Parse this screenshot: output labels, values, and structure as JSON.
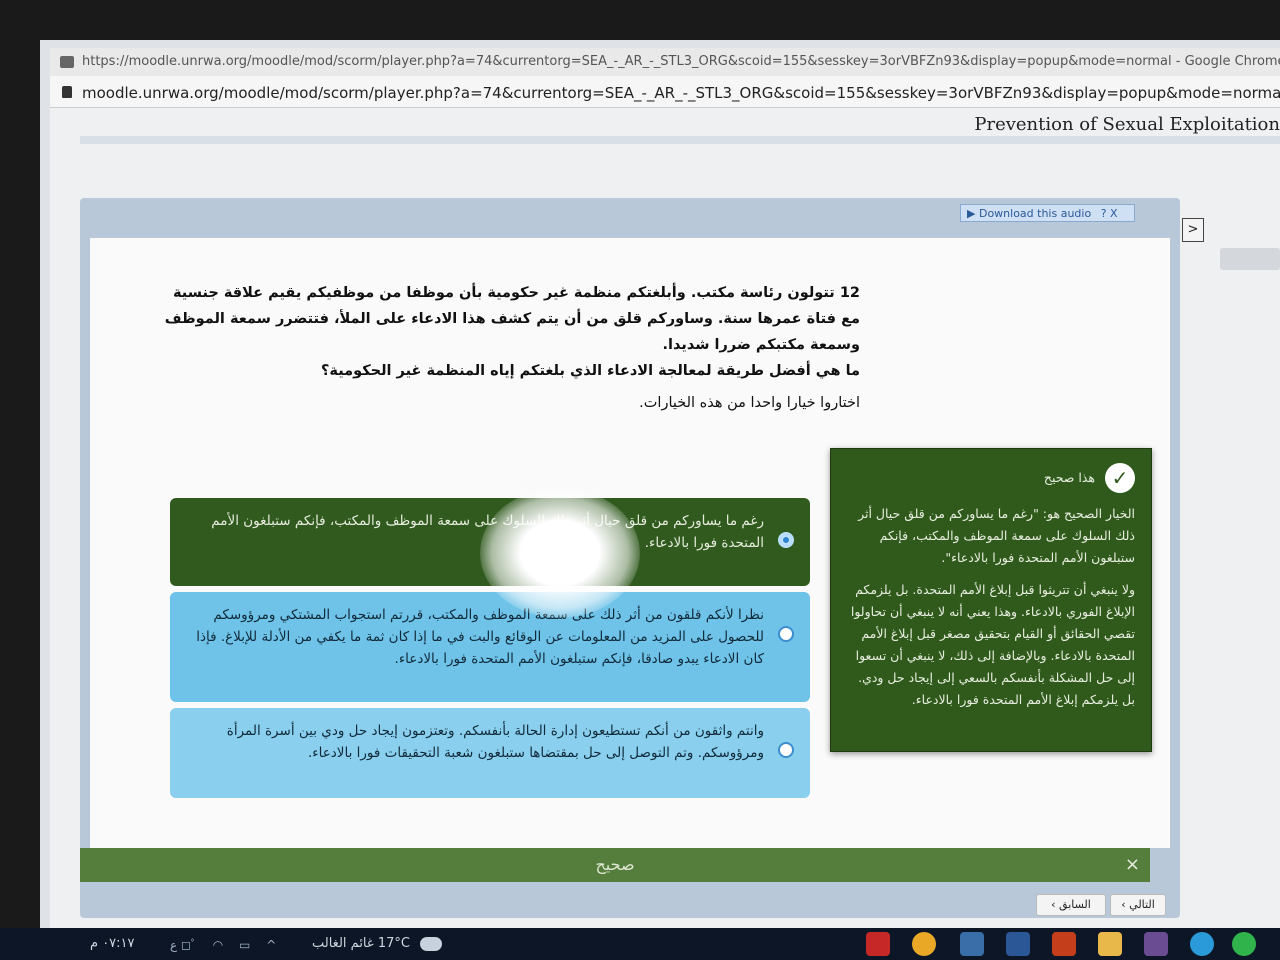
{
  "browser": {
    "title_bar": "https://moodle.unrwa.org/moodle/mod/scorm/player.php?a=74&currentorg=SEA_-_AR_-_STL3_ORG&scoid=155&sesskey=3orVBFZn93&display=popup&mode=normal - Google Chrome",
    "address": "moodle.unrwa.org/moodle/mod/scorm/player.php?a=74&currentorg=SEA_-_AR_-_STL3_ORG&scoid=155&sesskey=3orVBFZn93&display=popup&mode=normal"
  },
  "course": {
    "title": "Prevention of Sexual Exploitation"
  },
  "player": {
    "audio_label": "Download this audio",
    "audio_help": "? X",
    "side_next": ">"
  },
  "question": {
    "text": "12 تتولون رئاسة مكتب. وأبلغتكم منظمة غير حكومية بأن موظفا من موظفيكم يقيم علاقة جنسية مع فتاة عمرها سنة. وساوركم قلق من أن يتم كشف هذا الادعاء على الملأ، فتتضرر سمعة الموظف وسمعة مكتبكم ضررا شديدا.",
    "prompt": "ما هي أفضل طريقة لمعالجة الادعاء الذي بلغتكم إياه المنظمة غير الحكومية؟",
    "instruction": "اختاروا خيارا واحدا من هذه الخيارات."
  },
  "choices": [
    {
      "text": "رغم ما يساوركم من قلق حيال أثر ذلك السلوك على سمعة الموظف والمكتب، فإنكم ستبلغون الأمم المتحدة فورا بالادعاء.",
      "selected": true
    },
    {
      "text": "نظرا لأنكم قلقون من أثر ذلك على سمعة الموظف والمكتب، قررتم استجواب المشتكي ومرؤوسكم للحصول على المزيد من المعلومات عن الوقائع والبت في ما إذا كان ثمة ما يكفي من الأدلة للإبلاغ. فإذا كان الادعاء يبدو صادقا، فإنكم ستبلغون الأمم المتحدة فورا بالادعاء.",
      "selected": false
    },
    {
      "text": "وانتم واثقون من أنكم تستطيعون إدارة الحالة بأنفسكم. وتعتزمون إيجاد حل ودي بين أسرة المرأة ومرؤوسكم. وتم التوصل إلى حل بمقتضاها ستبلغون شعبة التحقيقات فورا بالادعاء.",
      "selected": false
    }
  ],
  "feedback": {
    "heading": "هذا صحيح",
    "paragraph1": "الخيار الصحيح هو: \"رغم ما يساوركم من قلق حيال أثر ذلك السلوك على سمعة الموظف والمكتب، فإنكم ستبلغون الأمم المتحدة فورا بالادعاء\".",
    "paragraph2": "ولا ينبغي أن تتريثوا قبل إبلاغ الأمم المتحدة. بل يلزمكم الإبلاغ الفوري بالادعاء. وهذا يعني أنه لا ينبغي أن تحاولوا تقصي الحقائق أو القيام بتحقيق مصغر قبل إبلاغ الأمم المتحدة بالادعاء. وبالإضافة إلى ذلك، لا ينبغي أن تسعوا إلى حل المشكلة بأنفسكم بالسعي إلى إيجاد حل ودي. بل يلزمكم إبلاغ الأمم المتحدة فورا بالادعاء."
  },
  "result": {
    "label": "صحيح",
    "close": "×"
  },
  "nav": {
    "prev": "السابق ›",
    "next": "التالي ›"
  },
  "taskbar": {
    "time": "٠٧:١٧ م",
    "sys_icons": "ع ◻ﾟ ◠ ▭ ^",
    "weather": "17°C غائم الغالب"
  },
  "colors": {
    "correct_green": "#2f5a1c",
    "choice_blue": "#6fc3e8",
    "result_bar": "#557d3c"
  }
}
